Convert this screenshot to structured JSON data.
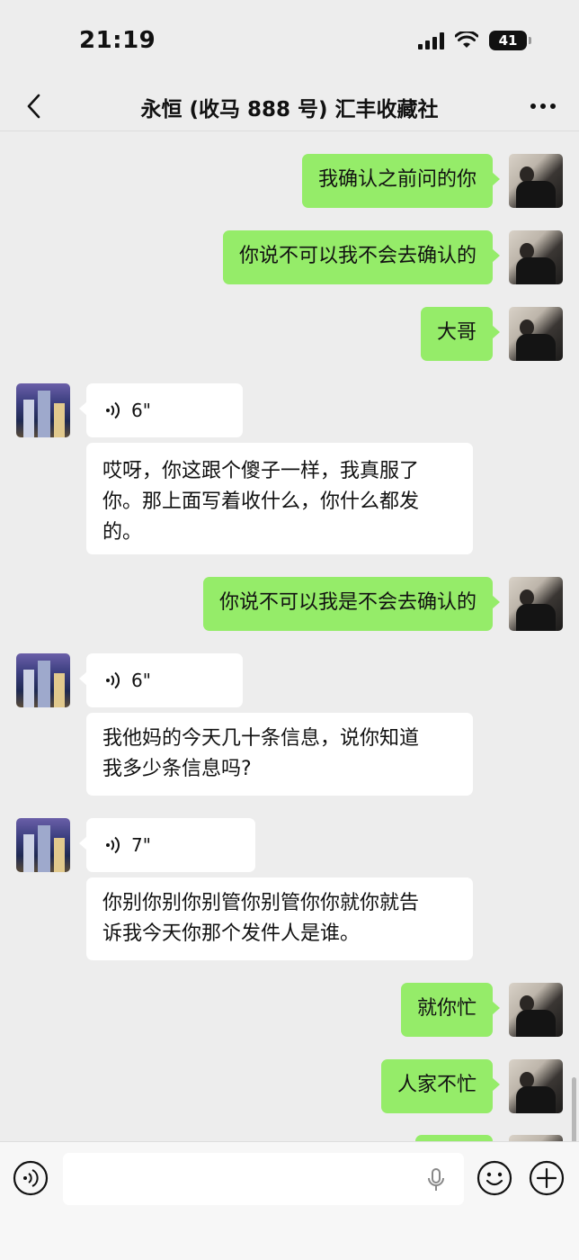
{
  "status": {
    "time": "21:19",
    "battery": "41"
  },
  "nav": {
    "title": "永恒 (收马 888 号) 汇丰收藏社"
  },
  "messages": {
    "m1": "我确认之前问的你",
    "m2": "你说不可以我不会去确认的",
    "m3": "大哥",
    "v1": "6\"",
    "t1_l1": "哎呀，你这跟个傻子一样，我真服了",
    "t1_l2": "你。那上面写着收什么，你什么都发",
    "t1_l3": "的。",
    "m4": "你说不可以我是不会去确认的",
    "v2": "6\"",
    "t2_l1": "我他妈的今天几十条信息，说你知道",
    "t2_l2": "我多少条信息吗?",
    "v3": "7\"",
    "t3_l1": "你别你别你别管你别管你你就你就告",
    "t3_l2": "诉我今天你那个发件人是谁。",
    "m5": "就你忙",
    "m6": "人家不忙"
  },
  "input": {
    "placeholder": ""
  },
  "colors": {
    "outgoing": "#95ec69",
    "incoming": "#ffffff",
    "background": "#ededed"
  },
  "icons": {
    "back": "chevron-left-icon",
    "more": "more-dots-icon",
    "voice": "voice-wave-icon",
    "mic": "mic-icon",
    "emoji": "emoji-icon",
    "plus": "plus-icon"
  }
}
